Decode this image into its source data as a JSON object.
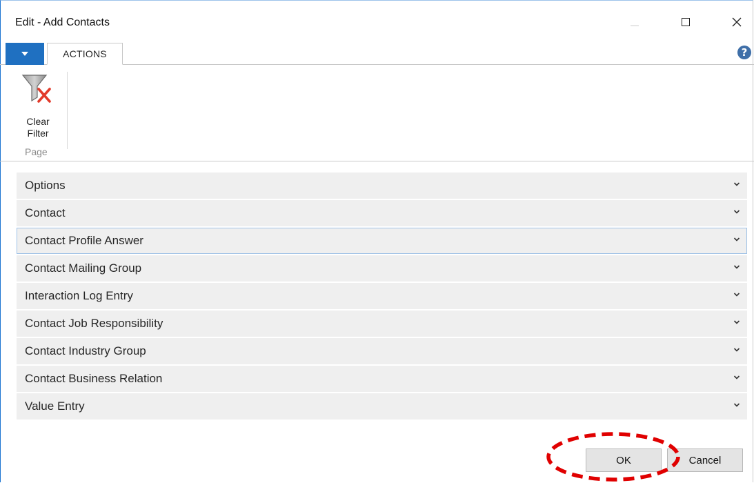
{
  "window": {
    "title": "Edit - Add Contacts"
  },
  "ribbon": {
    "tabs": [
      {
        "label": "ACTIONS",
        "active": true
      }
    ],
    "groups": [
      {
        "label": "Page",
        "buttons": [
          {
            "label": "Clear\nFilter",
            "icon": "clear-filter-icon"
          }
        ]
      }
    ]
  },
  "fasttabs": [
    {
      "label": "Options",
      "expanded": false
    },
    {
      "label": "Contact",
      "expanded": false
    },
    {
      "label": "Contact Profile Answer",
      "expanded": false,
      "selected": true
    },
    {
      "label": "Contact Mailing Group",
      "expanded": false
    },
    {
      "label": "Interaction Log Entry",
      "expanded": false
    },
    {
      "label": "Contact Job Responsibility",
      "expanded": false
    },
    {
      "label": "Contact Industry Group",
      "expanded": false
    },
    {
      "label": "Contact Business Relation",
      "expanded": false
    },
    {
      "label": "Value Entry",
      "expanded": false
    }
  ],
  "footer": {
    "ok_label": "OK",
    "cancel_label": "Cancel"
  },
  "help_glyph": "?",
  "colors": {
    "accent": "#1f70c1",
    "highlight": "#e00000",
    "fasttab_bg": "#efefef",
    "selected_border": "#9ec1e6"
  }
}
